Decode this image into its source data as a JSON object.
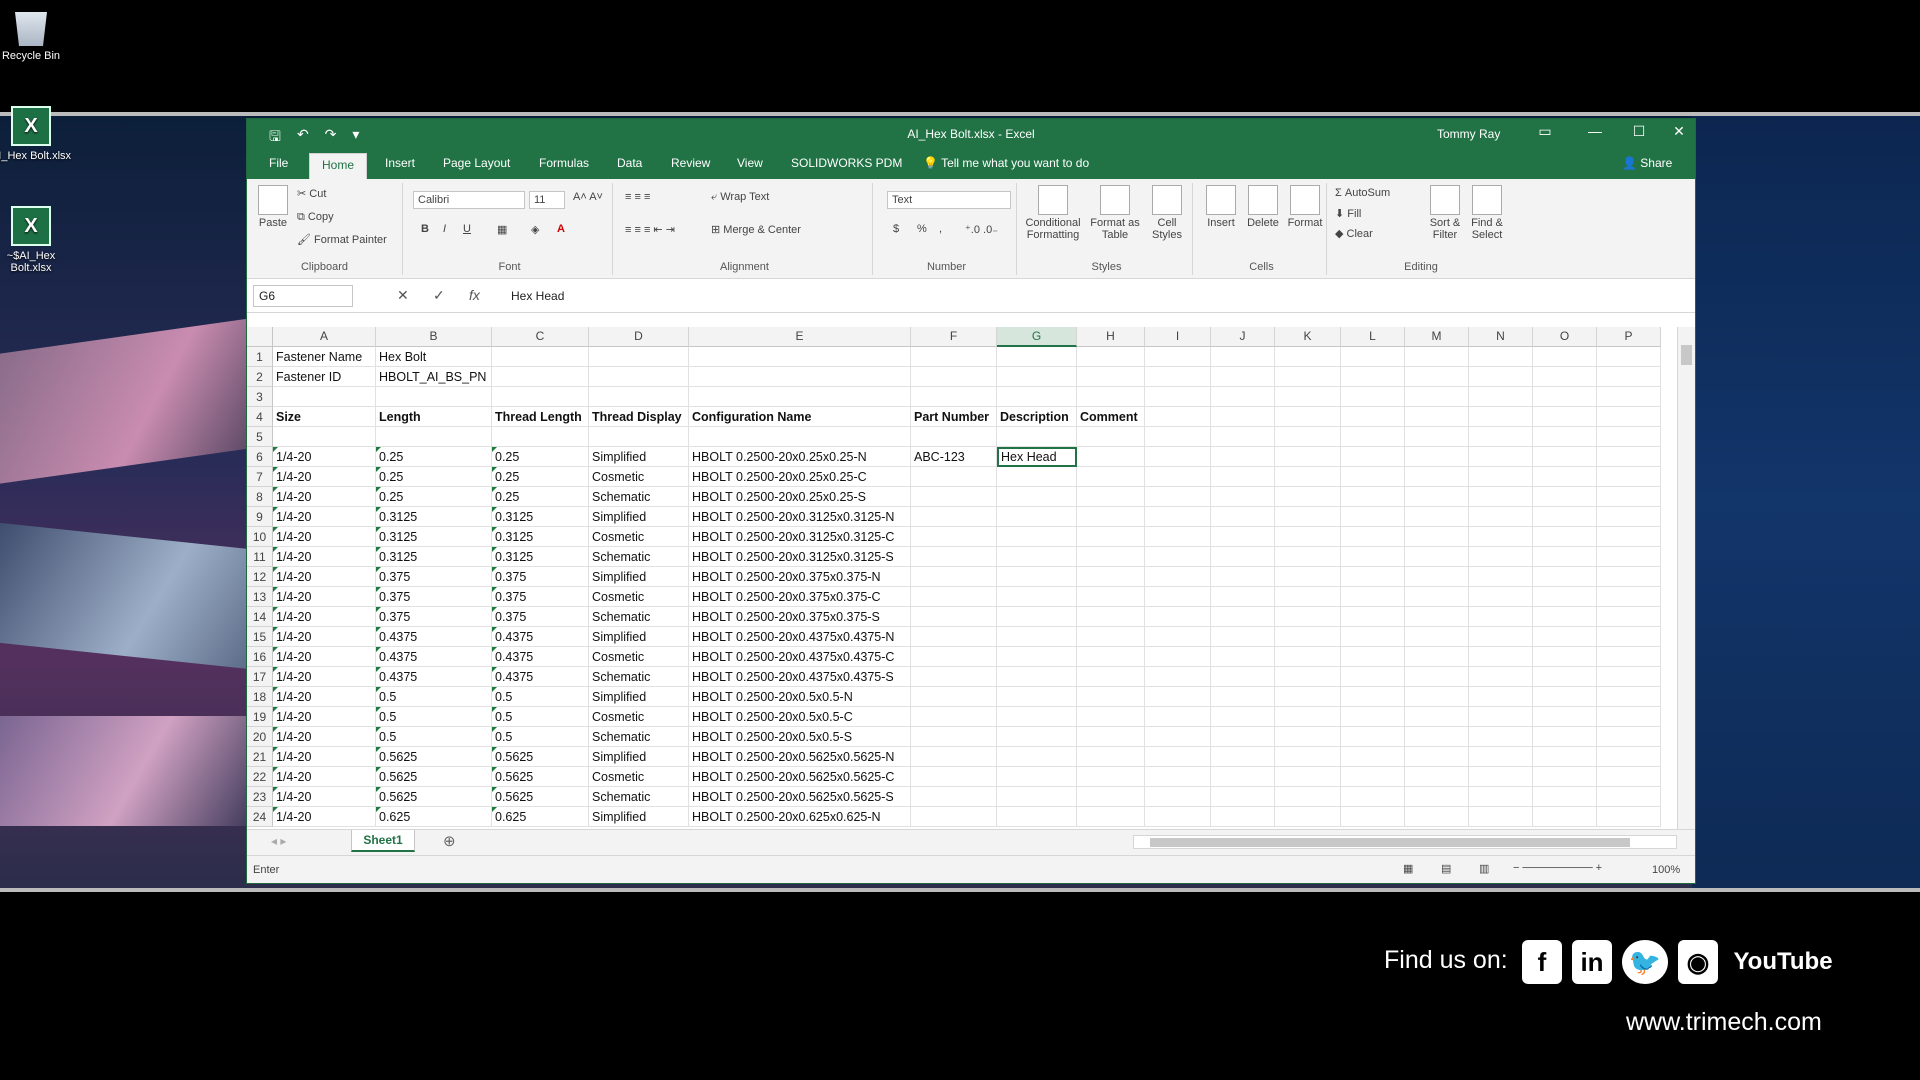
{
  "desktop": {
    "icons": [
      {
        "label": "Recycle Bin"
      },
      {
        "label": "AI_Hex Bolt.xlsx"
      },
      {
        "label": "~$AI_Hex Bolt.xlsx"
      }
    ]
  },
  "window": {
    "title": "AI_Hex Bolt.xlsx - Excel",
    "user": "Tommy Ray",
    "minimize": "—",
    "maximize": "☐",
    "close": "✕"
  },
  "tabs": [
    {
      "label": "File"
    },
    {
      "label": "Home"
    },
    {
      "label": "Insert"
    },
    {
      "label": "Page Layout"
    },
    {
      "label": "Formulas"
    },
    {
      "label": "Data"
    },
    {
      "label": "Review"
    },
    {
      "label": "View"
    },
    {
      "label": "SOLIDWORKS PDM"
    }
  ],
  "tell_me": "Tell me what you want to do",
  "share_label": "Share",
  "ribbon": {
    "clipboard": {
      "paste": "Paste",
      "cut": "Cut",
      "copy": "Copy",
      "format_painter": "Format Painter",
      "group": "Clipboard"
    },
    "font": {
      "name": "Calibri",
      "size": "11",
      "group": "Font",
      "bold": "B",
      "italic": "I",
      "underline": "U",
      "font_color": "A"
    },
    "alignment": {
      "wrap": "Wrap Text",
      "merge": "Merge & Center",
      "group": "Alignment"
    },
    "number": {
      "format": "Text",
      "currency": "$",
      "percent": "%",
      "comma": ",",
      "group": "Number"
    },
    "styles": {
      "conditional": "Conditional\nFormatting",
      "conditional_1": "Conditional",
      "conditional_2": "Formatting",
      "format_table_1": "Format as",
      "format_table_2": "Table",
      "cell_styles_1": "Cell",
      "cell_styles_2": "Styles",
      "group": "Styles"
    },
    "cells": {
      "insert": "Insert",
      "delete": "Delete",
      "format": "Format",
      "group": "Cells"
    },
    "editing": {
      "autosum": "AutoSum",
      "fill": "Fill",
      "clear": "Clear",
      "sort_1": "Sort &",
      "sort_2": "Filter",
      "find_1": "Find &",
      "find_2": "Select",
      "group": "Editing"
    }
  },
  "formula_bar": {
    "name_box": "G6",
    "cancel": "✕",
    "enter": "✓",
    "fx": "fx",
    "content": "Hex Head"
  },
  "columns": [
    "A",
    "B",
    "C",
    "D",
    "E",
    "F",
    "G",
    "H",
    "I",
    "J",
    "K",
    "L",
    "M",
    "N",
    "O",
    "P"
  ],
  "selected_column": "G",
  "rows": [
    {
      "n": "1",
      "cells": {
        "A": "Fastener Name",
        "B": "Hex Bolt"
      }
    },
    {
      "n": "2",
      "cells": {
        "A": "Fastener ID",
        "B": "HBOLT_AI_BS_PN"
      }
    },
    {
      "n": "3",
      "cells": {}
    },
    {
      "n": "4",
      "cells": {
        "A": "Size",
        "B": "Length",
        "C": "Thread Length",
        "D": "Thread Display",
        "E": "Configuration Name",
        "F": "Part Number",
        "G": "Description",
        "H": "Comment"
      },
      "bold": true
    },
    {
      "n": "5",
      "cells": {}
    },
    {
      "n": "6",
      "cells": {
        "A": "1/4-20",
        "B": "0.25",
        "C": "0.25",
        "D": "Simplified",
        "E": "HBOLT 0.2500-20x0.25x0.25-N",
        "F": "ABC-123",
        "G": "Hex Head"
      }
    },
    {
      "n": "7",
      "cells": {
        "A": "1/4-20",
        "B": "0.25",
        "C": "0.25",
        "D": "Cosmetic",
        "E": "HBOLT 0.2500-20x0.25x0.25-C"
      }
    },
    {
      "n": "8",
      "cells": {
        "A": "1/4-20",
        "B": "0.25",
        "C": "0.25",
        "D": "Schematic",
        "E": "HBOLT 0.2500-20x0.25x0.25-S"
      }
    },
    {
      "n": "9",
      "cells": {
        "A": "1/4-20",
        "B": "0.3125",
        "C": "0.3125",
        "D": "Simplified",
        "E": "HBOLT 0.2500-20x0.3125x0.3125-N"
      }
    },
    {
      "n": "10",
      "cells": {
        "A": "1/4-20",
        "B": "0.3125",
        "C": "0.3125",
        "D": "Cosmetic",
        "E": "HBOLT 0.2500-20x0.3125x0.3125-C"
      }
    },
    {
      "n": "11",
      "cells": {
        "A": "1/4-20",
        "B": "0.3125",
        "C": "0.3125",
        "D": "Schematic",
        "E": "HBOLT 0.2500-20x0.3125x0.3125-S"
      }
    },
    {
      "n": "12",
      "cells": {
        "A": "1/4-20",
        "B": "0.375",
        "C": "0.375",
        "D": "Simplified",
        "E": "HBOLT 0.2500-20x0.375x0.375-N"
      }
    },
    {
      "n": "13",
      "cells": {
        "A": "1/4-20",
        "B": "0.375",
        "C": "0.375",
        "D": "Cosmetic",
        "E": "HBOLT 0.2500-20x0.375x0.375-C"
      }
    },
    {
      "n": "14",
      "cells": {
        "A": "1/4-20",
        "B": "0.375",
        "C": "0.375",
        "D": "Schematic",
        "E": "HBOLT 0.2500-20x0.375x0.375-S"
      }
    },
    {
      "n": "15",
      "cells": {
        "A": "1/4-20",
        "B": "0.4375",
        "C": "0.4375",
        "D": "Simplified",
        "E": "HBOLT 0.2500-20x0.4375x0.4375-N"
      }
    },
    {
      "n": "16",
      "cells": {
        "A": "1/4-20",
        "B": "0.4375",
        "C": "0.4375",
        "D": "Cosmetic",
        "E": "HBOLT 0.2500-20x0.4375x0.4375-C"
      }
    },
    {
      "n": "17",
      "cells": {
        "A": "1/4-20",
        "B": "0.4375",
        "C": "0.4375",
        "D": "Schematic",
        "E": "HBOLT 0.2500-20x0.4375x0.4375-S"
      }
    },
    {
      "n": "18",
      "cells": {
        "A": "1/4-20",
        "B": "0.5",
        "C": "0.5",
        "D": "Simplified",
        "E": "HBOLT 0.2500-20x0.5x0.5-N"
      }
    },
    {
      "n": "19",
      "cells": {
        "A": "1/4-20",
        "B": "0.5",
        "C": "0.5",
        "D": "Cosmetic",
        "E": "HBOLT 0.2500-20x0.5x0.5-C"
      }
    },
    {
      "n": "20",
      "cells": {
        "A": "1/4-20",
        "B": "0.5",
        "C": "0.5",
        "D": "Schematic",
        "E": "HBOLT 0.2500-20x0.5x0.5-S"
      }
    },
    {
      "n": "21",
      "cells": {
        "A": "1/4-20",
        "B": "0.5625",
        "C": "0.5625",
        "D": "Simplified",
        "E": "HBOLT 0.2500-20x0.5625x0.5625-N"
      }
    },
    {
      "n": "22",
      "cells": {
        "A": "1/4-20",
        "B": "0.5625",
        "C": "0.5625",
        "D": "Cosmetic",
        "E": "HBOLT 0.2500-20x0.5625x0.5625-C"
      }
    },
    {
      "n": "23",
      "cells": {
        "A": "1/4-20",
        "B": "0.5625",
        "C": "0.5625",
        "D": "Schematic",
        "E": "HBOLT 0.2500-20x0.5625x0.5625-S"
      }
    },
    {
      "n": "24",
      "cells": {
        "A": "1/4-20",
        "B": "0.625",
        "C": "0.625",
        "D": "Simplified",
        "E": "HBOLT 0.2500-20x0.625x0.625-N"
      }
    }
  ],
  "active_cell": "G6",
  "sheet_tab": "Sheet1",
  "add_sheet": "⊕",
  "status": {
    "mode": "Enter",
    "zoom": "100%"
  },
  "branding": {
    "find_us": "Find us on:",
    "website": "www.trimech.com",
    "social": [
      {
        "icon": "facebook-icon",
        "glyph": "f"
      },
      {
        "icon": "linkedin-icon",
        "glyph": "in"
      },
      {
        "icon": "twitter-icon",
        "glyph": "🐦"
      },
      {
        "icon": "rss-icon",
        "glyph": "◉"
      },
      {
        "icon": "youtube-icon",
        "glyph": "YouTube"
      }
    ]
  },
  "colors": {
    "excel_green": "#217346",
    "desktop_bg": "#000000"
  }
}
